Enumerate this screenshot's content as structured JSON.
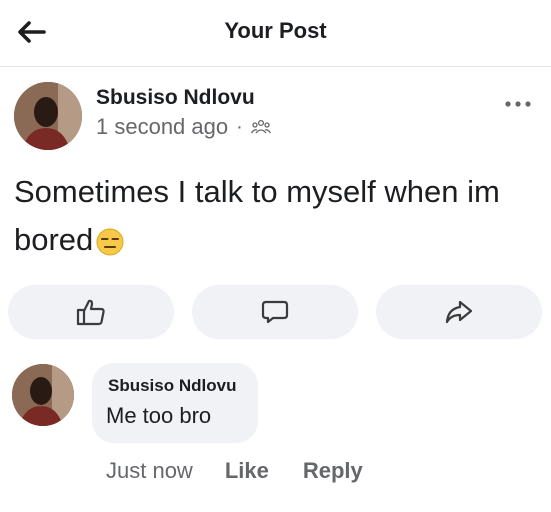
{
  "header": {
    "title": "Your Post",
    "back_icon": "arrow-left-icon"
  },
  "post": {
    "author": "Sbusiso Ndlovu",
    "time": "1 second ago",
    "separator": "·",
    "audience_icon": "friends-icon",
    "text": "Sometimes I talk to myself when im bored",
    "emoji_icon": "expressionless-face-icon",
    "more_icon": "more-dots-icon"
  },
  "actions": {
    "like_icon": "thumbs-up-icon",
    "comment_icon": "comment-icon",
    "share_icon": "share-icon"
  },
  "comment": {
    "author": "Sbusiso Ndlovu",
    "text": "Me too bro",
    "time": "Just now",
    "like_label": "Like",
    "reply_label": "Reply"
  },
  "colors": {
    "text": "#1c1e21",
    "secondary": "#65676b",
    "button_bg": "#f0f2f5",
    "emoji": "#f7c948"
  }
}
